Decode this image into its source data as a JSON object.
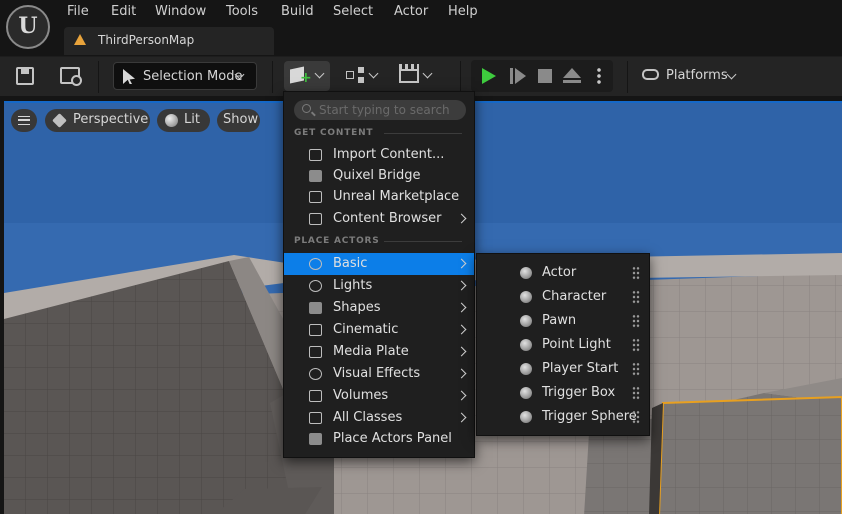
{
  "menubar": {
    "items": [
      "File",
      "Edit",
      "Window",
      "Tools",
      "Build",
      "Select",
      "Actor",
      "Help"
    ]
  },
  "tab": {
    "label": "ThirdPersonMap",
    "accent": "#e8a33b"
  },
  "toolbar": {
    "selection_mode_label": "Selection Mode",
    "platforms_label": "Platforms",
    "play_color": "#3ecb3e"
  },
  "viewport": {
    "perspective_label": "Perspective",
    "lit_label": "Lit",
    "show_label": "Show",
    "sky_color": "#2f63a8",
    "selection_outline": "#e8a020"
  },
  "add_menu": {
    "search_placeholder": "Start typing to search",
    "section_get_content": "GET CONTENT",
    "section_place_actors": "PLACE ACTORS",
    "get_content_items": [
      {
        "label": "Import Content...",
        "icon": "import-icon",
        "submenu": false
      },
      {
        "label": "Quixel Bridge",
        "icon": "bridge-icon",
        "submenu": false
      },
      {
        "label": "Unreal Marketplace",
        "icon": "marketplace-icon",
        "submenu": false
      },
      {
        "label": "Content Browser",
        "icon": "content-browser-icon",
        "submenu": true
      }
    ],
    "place_actors_items": [
      {
        "label": "Basic",
        "icon": "basic-actor-icon",
        "submenu": true,
        "active": true
      },
      {
        "label": "Lights",
        "icon": "light-icon",
        "submenu": true
      },
      {
        "label": "Shapes",
        "icon": "shapes-icon",
        "submenu": true
      },
      {
        "label": "Cinematic",
        "icon": "cinematic-icon",
        "submenu": true
      },
      {
        "label": "Media Plate",
        "icon": "media-plate-icon",
        "submenu": true
      },
      {
        "label": "Visual Effects",
        "icon": "vfx-icon",
        "submenu": true
      },
      {
        "label": "Volumes",
        "icon": "volume-icon",
        "submenu": true
      },
      {
        "label": "All Classes",
        "icon": "all-classes-icon",
        "submenu": true
      },
      {
        "label": "Place Actors Panel",
        "icon": "place-actors-icon",
        "submenu": false
      }
    ],
    "active_color": "#0c7ee8"
  },
  "basic_submenu": {
    "items": [
      {
        "label": "Actor",
        "icon": "actor-icon"
      },
      {
        "label": "Character",
        "icon": "character-icon"
      },
      {
        "label": "Pawn",
        "icon": "pawn-icon"
      },
      {
        "label": "Point Light",
        "icon": "point-light-icon"
      },
      {
        "label": "Player Start",
        "icon": "player-start-icon"
      },
      {
        "label": "Trigger Box",
        "icon": "trigger-box-icon"
      },
      {
        "label": "Trigger Sphere",
        "icon": "trigger-sphere-icon"
      }
    ]
  }
}
